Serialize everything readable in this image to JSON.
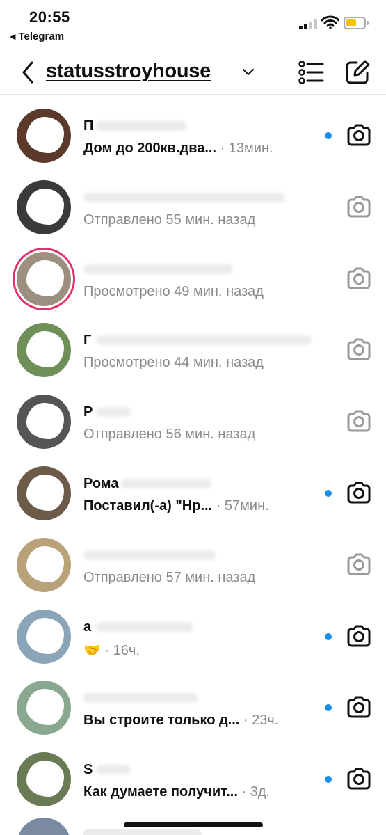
{
  "status_bar": {
    "time": "20:55",
    "back_app": "Telegram"
  },
  "header": {
    "title": "statusstroyhouse"
  },
  "threads": [
    {
      "name": "П",
      "message": "Дом до 200кв.два...",
      "time": " · 13мин.",
      "unread": true,
      "avatar_color": "#5b3a2c",
      "name_blur_w": 130
    },
    {
      "name": "",
      "message": "Отправлено 55 мин. назад",
      "time": "",
      "unread": false,
      "avatar_color": "#3a3a3a",
      "name_blur_w": 290
    },
    {
      "name": "",
      "message": "Просмотрено 49 мин. назад",
      "time": "",
      "unread": false,
      "avatar_color": "#9c8f7f",
      "name_blur_w": 215,
      "story_ring": true
    },
    {
      "name": "Г",
      "message": "Просмотрено 44 мин. назад",
      "time": "",
      "unread": false,
      "avatar_color": "#6f8f59",
      "name_blur_w": 310
    },
    {
      "name": "Р",
      "message": "Отправлено 56 мин. назад",
      "time": "",
      "unread": false,
      "avatar_color": "#555555",
      "name_blur_w": 50
    },
    {
      "name": "Рома",
      "message": "Поставил(-а) \"Нр...",
      "time": " · 57мин.",
      "unread": true,
      "avatar_color": "#6d5b4a",
      "name_blur_w": 130
    },
    {
      "name": "",
      "message": "Отправлено 57 мин. назад",
      "time": "",
      "unread": false,
      "avatar_color": "#b9a27a",
      "name_blur_w": 190
    },
    {
      "name": "a",
      "message": "🤝",
      "time": " · 16ч.",
      "unread": true,
      "avatar_color": "#8aa4b8",
      "name_blur_w": 140
    },
    {
      "name": "",
      "message": "Вы строите только д...",
      "time": " · 23ч.",
      "unread": true,
      "avatar_color": "#8aa890",
      "name_blur_w": 165
    },
    {
      "name": "S",
      "message": "Как думаете получит...",
      "time": " · 3д.",
      "unread": true,
      "avatar_color": "#6a7a55",
      "name_blur_w": 50
    }
  ],
  "colors": {
    "unread_dot": "#1a8cf0",
    "story_ring": "#e0336b",
    "muted_text": "#8a8a8a"
  }
}
